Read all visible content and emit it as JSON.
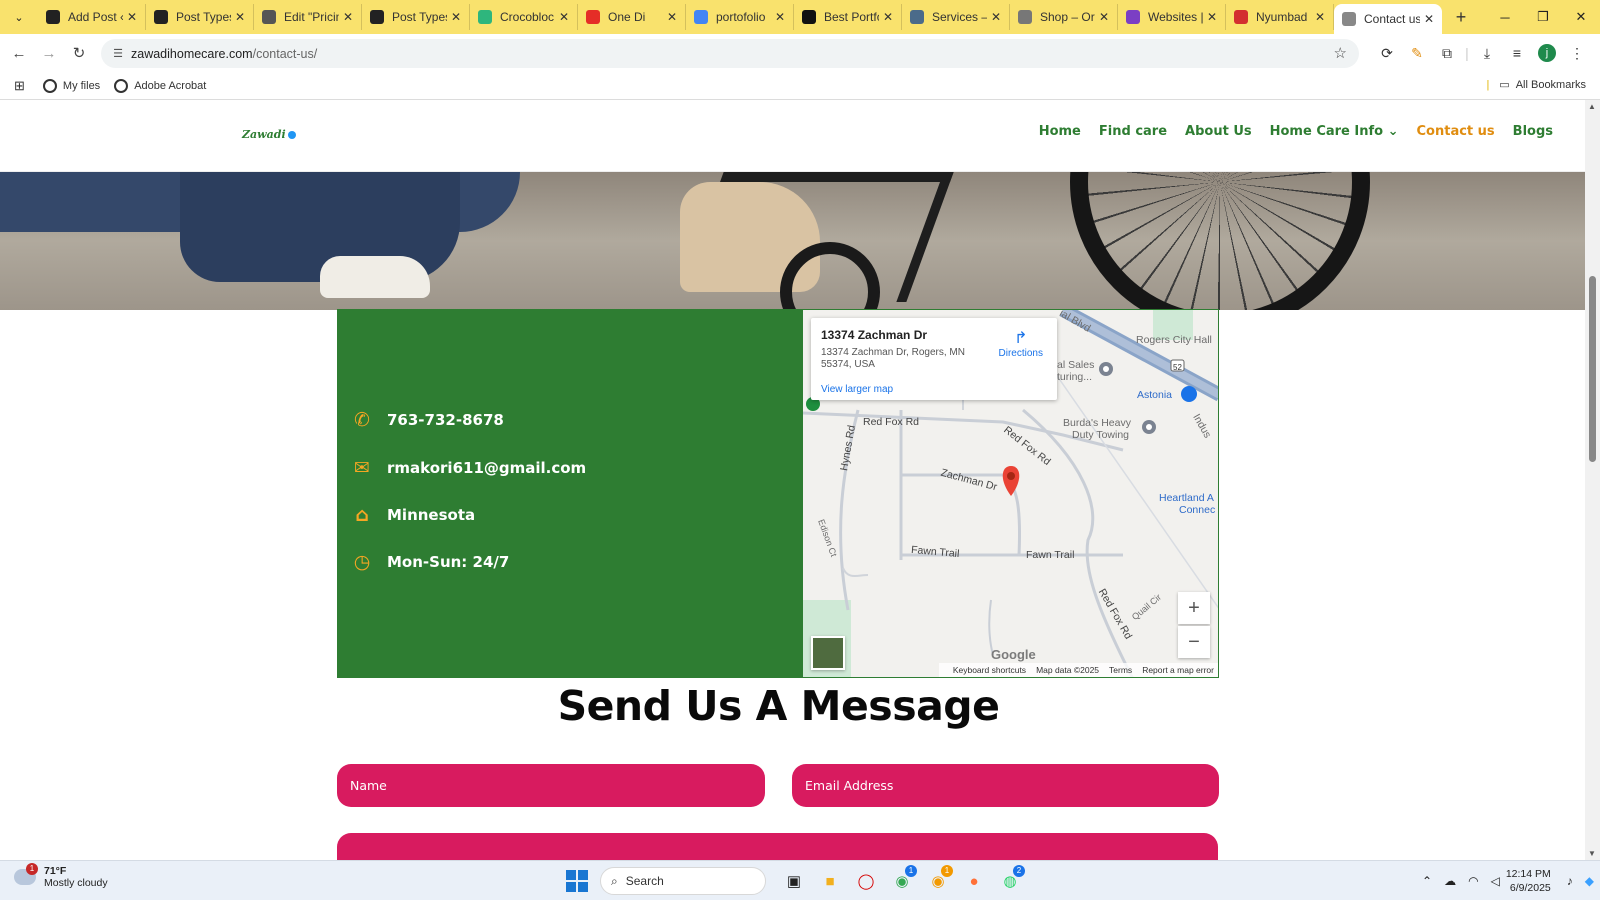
{
  "browser": {
    "tabs": [
      {
        "label": "Add Post ‹",
        "icon": "rtc-icon",
        "color": "#222222"
      },
      {
        "label": "Post Types",
        "icon": "rtc-icon",
        "color": "#222222"
      },
      {
        "label": "Edit \"Pricin",
        "icon": "wordpress-icon",
        "color": "#555555"
      },
      {
        "label": "Post Types",
        "icon": "rtc-icon",
        "color": "#222222"
      },
      {
        "label": "Crocobloc",
        "icon": "crocoblock-icon",
        "color": "#2eb67d"
      },
      {
        "label": "One Di",
        "icon": "youtube-icon",
        "color": "#e52d27"
      },
      {
        "label": "portofolio",
        "icon": "google-icon",
        "color": "#4285f4"
      },
      {
        "label": "Best Portfo",
        "icon": "w-icon",
        "color": "#111111"
      },
      {
        "label": "Services –",
        "icon": "site-icon",
        "color": "#4b6b8a"
      },
      {
        "label": "Shop – Or",
        "icon": "shop-icon",
        "color": "#777777"
      },
      {
        "label": "Websites |",
        "icon": "websites-icon",
        "color": "#7b3fc4"
      },
      {
        "label": "Nyumbad",
        "icon": "acrobat-icon",
        "color": "#d32f2f"
      },
      {
        "label": "Contact us",
        "icon": "page-icon",
        "color": "#888888"
      }
    ],
    "url_domain": "zawadihomecare.com",
    "url_path": "/contact-us/",
    "bookmarks": [
      {
        "label": "My files"
      },
      {
        "label": "Adobe Acrobat"
      }
    ],
    "all_bookmarks": "All Bookmarks",
    "profile_initial": "j"
  },
  "site": {
    "logo_text": "Zawadi",
    "menu": [
      {
        "label": "Home"
      },
      {
        "label": "Find care"
      },
      {
        "label": "About Us"
      },
      {
        "label": "Home Care Info ⌄"
      },
      {
        "label": "Contact us"
      },
      {
        "label": "Blogs"
      }
    ],
    "accent_color": "#2e7d32",
    "active_color": "#e08d10"
  },
  "contact": {
    "phone": "763-732-8678",
    "email": "rmakori611@gmail.com",
    "location": "Minnesota",
    "hours": "Mon-Sun: 24/7"
  },
  "map": {
    "place_title": "13374 Zachman Dr",
    "place_address": "13374 Zachman Dr, Rogers, MN 55374, USA",
    "view_larger": "View larger map",
    "directions": "Directions",
    "labels": {
      "blvd": "ial Blvd",
      "rogers_city_hall": "Rogers City Hall",
      "sales": "al Sales",
      "turing": "turing...",
      "astonia": "Astonia",
      "red_fox_rd_1": "Red Fox Rd",
      "red_fox_rd_2": "Red Fox Rd",
      "red_fox_rd_3": "Red Fox Rd",
      "burdas": "Burda's Heavy",
      "duty": "Duty Towing",
      "hynes": "Hynes Rd",
      "zachman": "Zachman Dr",
      "heartland": "Heartland A",
      "connect": "Connec",
      "indus": "Indus",
      "edison": "Edison Ct",
      "fawn1": "Fawn Trail",
      "fawn2": "Fawn Trail",
      "quail": "Quail Cir",
      "route": "52"
    },
    "footer": {
      "shortcuts": "Keyboard shortcuts",
      "mapdata": "Map data ©2025",
      "terms": "Terms",
      "report": "Report a map error"
    },
    "google": "Google"
  },
  "form": {
    "heading": "Send Us A Message",
    "name_placeholder": "Name",
    "email_placeholder": "Email Address",
    "field_color": "#d81b5f"
  },
  "taskbar": {
    "temperature": "71°F",
    "condition": "Mostly cloudy",
    "weather_badge": "1",
    "search": "Search",
    "time": "12:14 PM",
    "date": "6/9/2025",
    "chrome_badge_1": "1",
    "chrome_badge_2": "1",
    "whatsapp_badge": "2"
  }
}
